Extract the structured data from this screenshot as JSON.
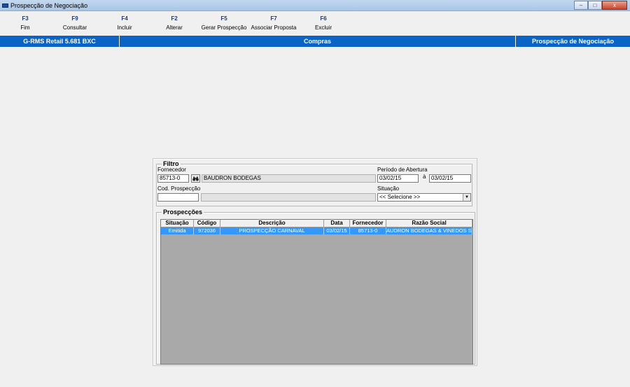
{
  "window": {
    "title": "Prospecção de Negociação",
    "minimize": "–",
    "maximize": "□",
    "close": "x"
  },
  "toolbar": [
    {
      "key": "F3",
      "label": "Fim"
    },
    {
      "key": "F9",
      "label": "Consultar"
    },
    {
      "key": "F4",
      "label": "Incluir"
    },
    {
      "key": "F2",
      "label": "Alterar"
    },
    {
      "key": "F5",
      "label": "Gerar Prospecção"
    },
    {
      "key": "F7",
      "label": "Associar Proposta"
    },
    {
      "key": "F6",
      "label": "Excluir"
    }
  ],
  "header": {
    "app": "G-RMS Retail 5.681 BXC",
    "module": "Compras",
    "screen": "Prospecção de Negociação"
  },
  "filtro": {
    "title": "Filtro",
    "fornecedor_label": "Fornecedor",
    "fornecedor_code": "85713-0",
    "fornecedor_name": "BAUDRON BODEGAS",
    "periodo_label": "Período de Abertura",
    "periodo_de": "03/02/15",
    "periodo_sep": "à",
    "periodo_ate": "03/02/15",
    "cod_prospeccao_label": "Cod. Prospecção",
    "cod_prospeccao_value": "",
    "cod_prospeccao_desc": "",
    "situacao_label": "Situação",
    "situacao_value": "<< Selecione >>"
  },
  "prospeccoes": {
    "title": "Prospecções",
    "columns": [
      "Situação",
      "Código",
      "Descrição",
      "Data",
      "Fornecedor",
      "Razão Social"
    ],
    "rows": [
      [
        "Emitida",
        "972036",
        "PROSPECÇÃO CARNAVAL",
        "03/02/15",
        "85713-0",
        "AUDRON BODEGAS & VINEDOS S."
      ]
    ]
  },
  "colors": {
    "header_bg": "#0b63c5",
    "selected_row": "#3399ff",
    "grid_bg": "#a9a9a9"
  }
}
